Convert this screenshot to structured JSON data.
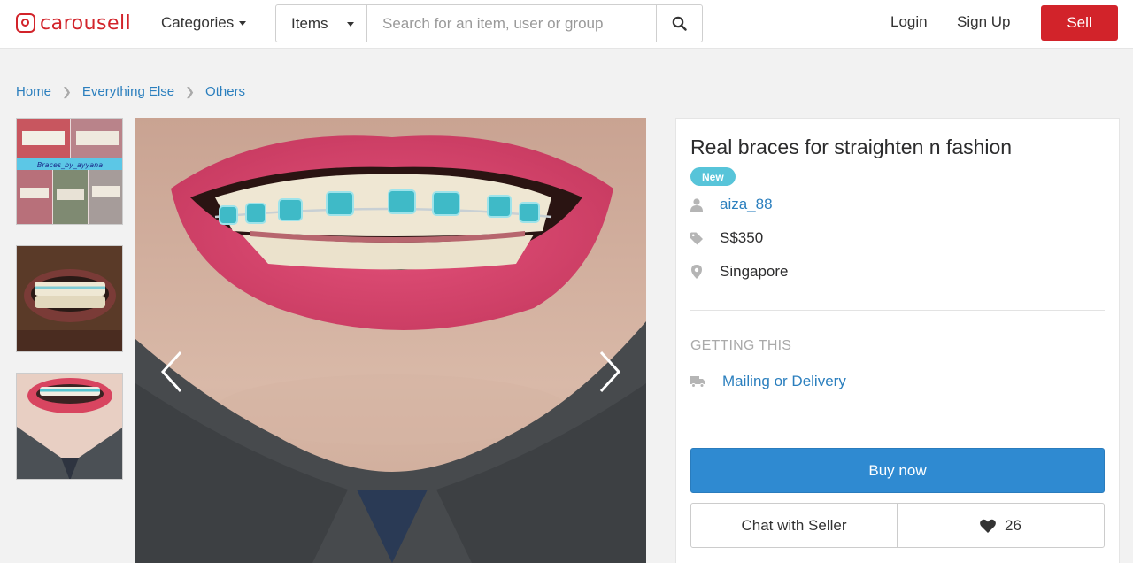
{
  "header": {
    "logo_text": "carousell",
    "categories_label": "Categories",
    "search_type": "Items",
    "search_placeholder": "Search for an item, user or group",
    "login_label": "Login",
    "signup_label": "Sign Up",
    "sell_label": "Sell"
  },
  "breadcrumb": [
    "Home",
    "Everything Else",
    "Others"
  ],
  "gallery": {
    "thumbnails": [
      {
        "caption": "Braces_by_ayyana"
      },
      {
        "caption": ""
      },
      {
        "caption": ""
      }
    ],
    "selected_index": 2
  },
  "listing": {
    "title": "Real braces for straighten n fashion",
    "condition_badge": "New",
    "seller": "aiza_88",
    "price": "S$350",
    "location": "Singapore",
    "getting_this_label": "GETTING THIS",
    "delivery": "Mailing or Delivery",
    "buy_label": "Buy now",
    "chat_label": "Chat with Seller",
    "likes": "26"
  },
  "colors": {
    "brand_red": "#d2232a",
    "link_blue": "#2b7fbe",
    "buy_blue": "#2f8ad1",
    "badge_teal": "#57c4d9"
  },
  "icons": {
    "seller": "user-icon",
    "price": "tag-icon",
    "location": "map-pin-icon",
    "delivery": "truck-icon",
    "like": "heart-icon",
    "search": "search-icon"
  }
}
